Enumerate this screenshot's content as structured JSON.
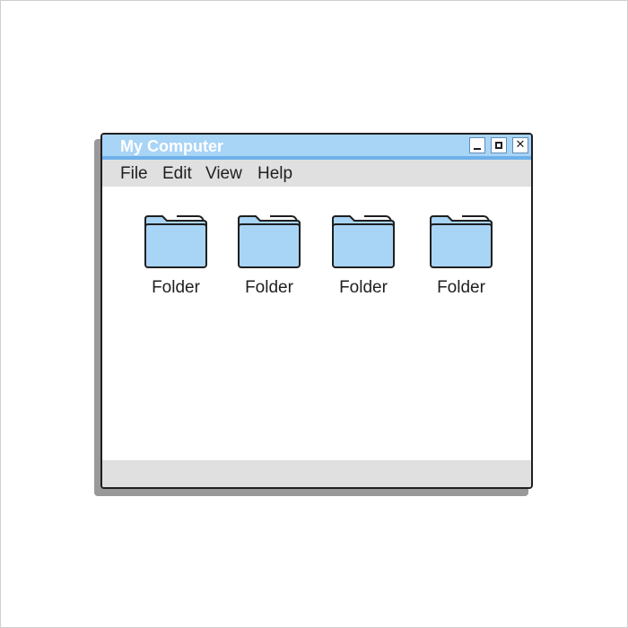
{
  "window": {
    "title": "My Computer",
    "controls": {
      "minimize_icon": "minimize-icon",
      "maximize_icon": "maximize-icon",
      "close_icon": "close-icon",
      "close_glyph": "✕"
    }
  },
  "menu": {
    "items": [
      {
        "label": "File"
      },
      {
        "label": "Edit"
      },
      {
        "label": "View"
      },
      {
        "label": "Help"
      }
    ]
  },
  "folders": [
    {
      "label": "Folder",
      "icon": "folder-icon"
    },
    {
      "label": "Folder",
      "icon": "folder-icon"
    },
    {
      "label": "Folder",
      "icon": "folder-icon"
    },
    {
      "label": "Folder",
      "icon": "folder-icon"
    }
  ],
  "colors": {
    "titlebar": "#a8d4f6",
    "titlebar_accent": "#6fb1ea",
    "folder_fill": "#a8d4f6",
    "chrome_gray": "#e0e0e0",
    "outline": "#1f1f1f"
  }
}
